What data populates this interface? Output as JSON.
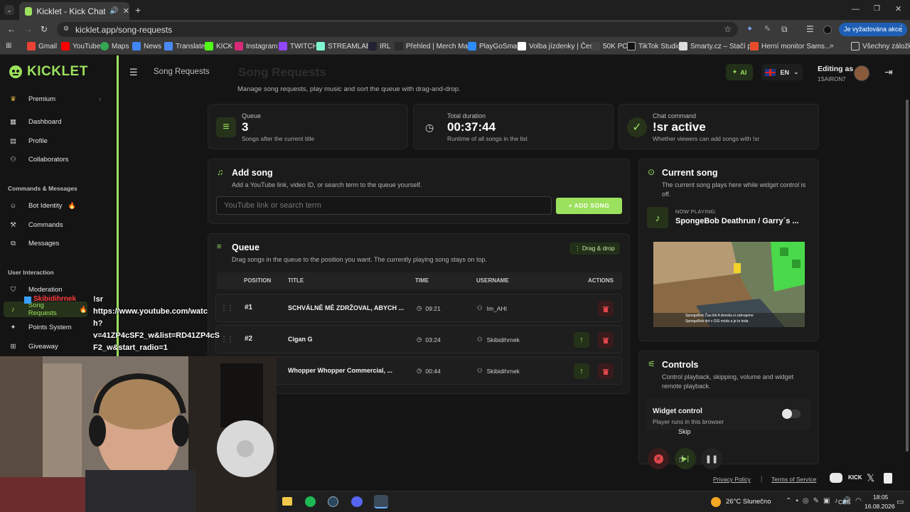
{
  "browser": {
    "tab_title": "Kicklet - Kick Chatbot, Kick",
    "url": "kicklet.app/song-requests",
    "action_badge": "Je vyžadována akce",
    "bookmarks": [
      "Gmail",
      "YouTube",
      "Maps",
      "News",
      "Translate",
      "KICK",
      "Instagram",
      "TWITCH",
      "STREAMLABS",
      "IRL",
      "Přehled | Merch Ma...",
      "PlayGoSmart",
      "Volba jízdenky | Čes...",
      "50K PC",
      "TikTok Studio",
      "Smarty.cz – Stačí pl...",
      "Herní monitor Sams..."
    ],
    "all_bookmarks": "Všechny záložky"
  },
  "app": {
    "brand": "KICKLET",
    "page_title": "Song Requests",
    "heading_faded": "Song Requests",
    "heading_desc": "Manage song requests, play music and sort the queue with drag-and-drop.",
    "ai_label": "AI",
    "lang": "EN",
    "editing_as": "Editing as",
    "username": "1SAIRON7"
  },
  "sidebar": {
    "premium": "Premium",
    "dashboard": "Dashboard",
    "profile": "Profile",
    "collaborators": "Collaborators",
    "section_commands": "Commands & Messages",
    "bot_identity": "Bot Identity",
    "commands": "Commands",
    "messages": "Messages",
    "section_user": "User Interaction",
    "moderation": "Moderation",
    "song_requests": "Song Requests",
    "points": "Points System",
    "giveaway": "Giveaway"
  },
  "stats": [
    {
      "label": "Queue",
      "value": "3",
      "sub": "Songs after the current title"
    },
    {
      "label": "Total duration",
      "value": "00:37:44",
      "sub": "Runtime of all songs in the list"
    },
    {
      "label": "Chat command",
      "value": "!sr active",
      "sub": "Whether viewers can add songs with !sr"
    }
  ],
  "add_song": {
    "title": "Add song",
    "desc": "Add a YouTube link, video ID, or search term to the queue yourself.",
    "placeholder": "YouTube link or search term",
    "button": "+ ADD SONG"
  },
  "queue": {
    "title": "Queue",
    "desc": "Drag songs in the queue to the position you want. The currently playing song stays on top.",
    "drag_badge": "Drag & drop",
    "columns": [
      "POSITION",
      "TITLE",
      "TIME",
      "USERNAME",
      "ACTIONS"
    ],
    "rows": [
      {
        "pos": "#1",
        "title": "SCHVÁLNĚ MĚ ZDRŽOVAL, ABYCH ...",
        "time": "09:21",
        "user": "Im_AHI"
      },
      {
        "pos": "#2",
        "title": "Cigan G",
        "time": "03:24",
        "user": "Skibidihrnek"
      },
      {
        "pos": "#3",
        "title": "Whopper Whopper Commercial, ...",
        "time": "00:44",
        "user": "Skibidihrnek"
      }
    ]
  },
  "current_song": {
    "title": "Current song",
    "desc": "The current song plays here while widget control is off.",
    "now_playing_label": "NOW PLAYING:",
    "now_playing": "SpongeBob Deathrun / Garry´s ...",
    "video_caption_1": "SpongeBob Čau lidi A dneska si zahrajeme",
    "video_caption_2": "SpongeBob dnt v GIS módu a je to teda"
  },
  "controls": {
    "title": "Controls",
    "desc": "Control playback, skipping, volume and widget remote playback.",
    "widget_label": "Widget control",
    "widget_sub": "Player runs in this browser",
    "skip_tooltip": "Skip"
  },
  "footer": {
    "privacy": "Privacy Policy",
    "separator": "|",
    "terms": "Terms of Service"
  },
  "chat_overlay": {
    "user": "Skibidihrnek",
    "message": "!sr https://www.youtube.com/watch?v=41ZP4cSF2_w&list=RD41ZP4cSF2_w&start_radio=1",
    "lines": [
      "!sr",
      "https://www.youtube.com/watc",
      "h?",
      "v=41ZP4cSF2_w&list=RD41ZP4cS",
      "F2_w&start_radio=1"
    ]
  },
  "taskbar": {
    "weather": "26°C Slunečno",
    "lang": "CES",
    "time": "18:05",
    "date": "16.08.2026"
  },
  "colors": {
    "accent": "#9be15d",
    "danger": "#e0474c",
    "bg": "#141414",
    "card": "#1b1b1b"
  }
}
